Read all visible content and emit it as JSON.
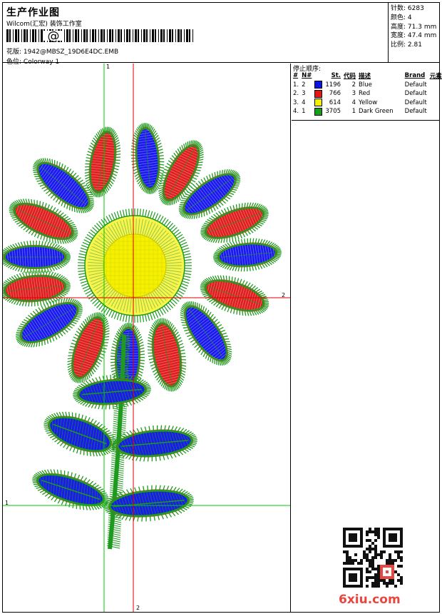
{
  "header": {
    "title": "生产作业图",
    "company": "Wilcom(汇宏) 装饰工作室",
    "design_label": "花版:",
    "design_file": "1942@MBSZ_19D6E4DC.EMB",
    "colorway_label": "色位:",
    "colorway": "Colorway 1"
  },
  "stats": [
    {
      "label": "针数:",
      "value": "6283"
    },
    {
      "label": "颜色:",
      "value": "4"
    },
    {
      "label": "高度:",
      "value": "71.3 mm"
    },
    {
      "label": "宽度:",
      "value": "47.4 mm"
    },
    {
      "label": "比例:",
      "value": "2.81"
    }
  ],
  "stop_sequence": {
    "title": "停止顺序:",
    "headers": [
      "#",
      "N#",
      "St.",
      "代码",
      "描述",
      "Brand",
      "元素"
    ],
    "rows": [
      {
        "idx": "1.",
        "n": "2",
        "st": "1196",
        "code": "2",
        "desc": "Blue",
        "brand": "Default",
        "color": "#0a14e6"
      },
      {
        "idx": "2.",
        "n": "3",
        "st": "766",
        "code": "3",
        "desc": "Red",
        "brand": "Default",
        "color": "#e61414"
      },
      {
        "idx": "3.",
        "n": "4",
        "st": "614",
        "code": "4",
        "desc": "Yellow",
        "brand": "Default",
        "color": "#f5f000"
      },
      {
        "idx": "4.",
        "n": "1",
        "st": "3705",
        "code": "1",
        "desc": "Dark Green",
        "brand": "Default",
        "color": "#14a014"
      }
    ]
  },
  "axes": {
    "v1": "1",
    "h2": "2",
    "h1": "1",
    "v2": "2"
  },
  "watermark": "6xiu.com",
  "colors": {
    "green": "#1e9a1e",
    "blue": "#1a1aee",
    "red": "#e02020",
    "yellow": "#f5f000",
    "olive": "#8a5a1a"
  }
}
